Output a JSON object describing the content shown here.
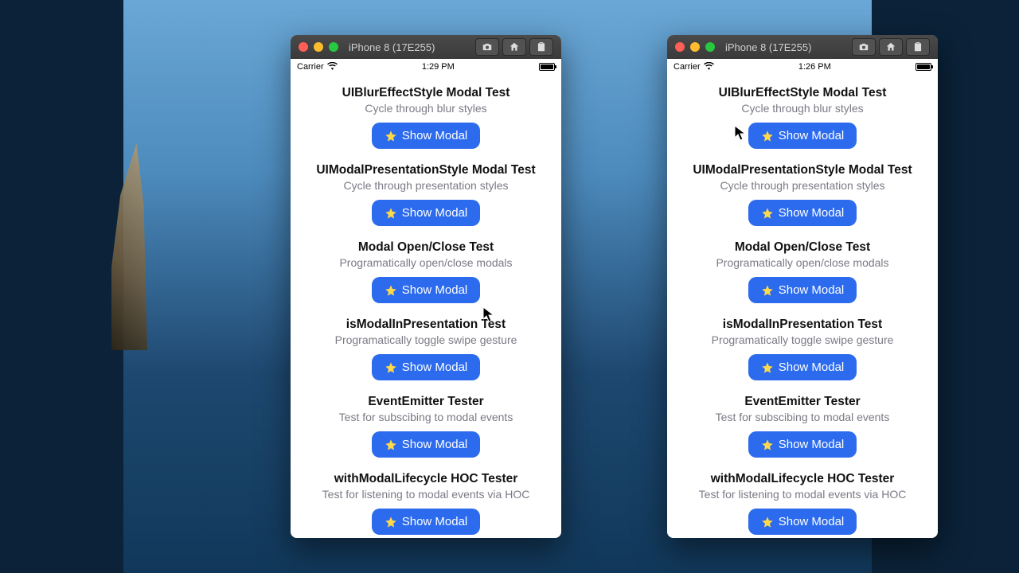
{
  "simulator": {
    "title": "iPhone 8 (17E255)",
    "toolbar_icons": [
      "camera-icon",
      "home-icon",
      "clipboard-icon"
    ]
  },
  "screens": [
    {
      "status": {
        "carrier": "Carrier",
        "time": "1:29 PM"
      },
      "button_label": "Show Modal",
      "cards": [
        {
          "title": "UIBlurEffectStyle Modal Test",
          "subtitle": "Cycle through blur styles"
        },
        {
          "title": "UIModalPresentationStyle Modal Test",
          "subtitle": "Cycle through presentation styles"
        },
        {
          "title": "Modal Open/Close Test",
          "subtitle": "Programatically open/close modals"
        },
        {
          "title": "isModalInPresentation Test",
          "subtitle": "Programatically toggle swipe gesture"
        },
        {
          "title": "EventEmitter Tester",
          "subtitle": "Test for subscibing to modal events"
        },
        {
          "title": "withModalLifecycle HOC Tester",
          "subtitle": "Test for listening to modal events via HOC"
        }
      ]
    },
    {
      "status": {
        "carrier": "Carrier",
        "time": "1:26 PM"
      },
      "button_label": "Show Modal",
      "cards": [
        {
          "title": "UIBlurEffectStyle Modal Test",
          "subtitle": "Cycle through blur styles"
        },
        {
          "title": "UIModalPresentationStyle Modal Test",
          "subtitle": "Cycle through presentation styles"
        },
        {
          "title": "Modal Open/Close Test",
          "subtitle": "Programatically open/close modals"
        },
        {
          "title": "isModalInPresentation Test",
          "subtitle": "Programatically toggle swipe gesture"
        },
        {
          "title": "EventEmitter Tester",
          "subtitle": "Test for subscibing to modal events"
        },
        {
          "title": "withModalLifecycle HOC Tester",
          "subtitle": "Test for listening to modal events via HOC"
        }
      ]
    }
  ]
}
